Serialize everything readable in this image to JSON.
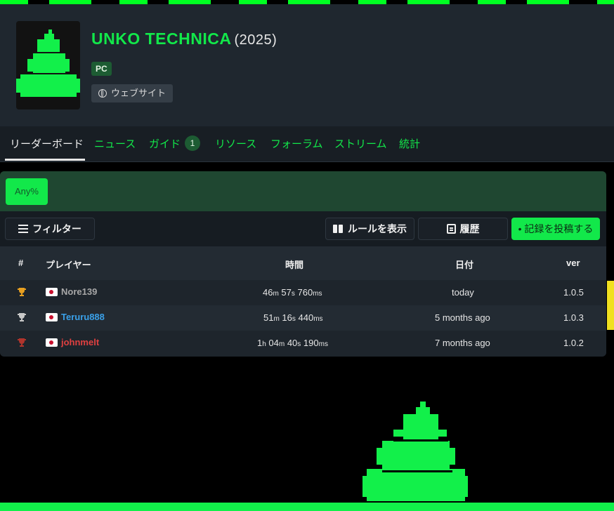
{
  "game": {
    "title": "UNKO TECHNICA",
    "year": "(2025)",
    "platform": "PC",
    "website_label": "ウェブサイト"
  },
  "tabs": [
    {
      "label": "リーダーボード",
      "active": true
    },
    {
      "label": "ニュース"
    },
    {
      "label": "ガイド",
      "badge": "1"
    },
    {
      "label": "リソース"
    },
    {
      "label": "フォーラム"
    },
    {
      "label": "ストリーム"
    },
    {
      "label": "統計"
    }
  ],
  "category": {
    "label": "Any%"
  },
  "toolbar": {
    "filter": "フィルター",
    "rules": "ルールを表示",
    "history": "履歴",
    "submit": "• 記録を投稿する"
  },
  "table": {
    "headers": {
      "rank": "#",
      "player": "プレイヤー",
      "time": "時間",
      "date": "日付",
      "ver": "ver"
    },
    "rows": [
      {
        "trophy": "gold-trophy-icon",
        "player": "Nore139",
        "time": {
          "p1": "46",
          "u1": "m",
          "p2": " 57",
          "u2": "s",
          "p3": " 760",
          "u3": "ms"
        },
        "date": "today",
        "ver": "1.0.5"
      },
      {
        "trophy": "silver-trophy-icon",
        "player": "Teruru888",
        "time": {
          "p1": "51",
          "u1": "m",
          "p2": " 16",
          "u2": "s",
          "p3": " 440",
          "u3": "ms"
        },
        "date": "5 months ago",
        "ver": "1.0.3"
      },
      {
        "trophy": "bronze-trophy-icon",
        "player": "johnmelt",
        "time": {
          "p0": "1",
          "u0": "h",
          "p1": " 04",
          "u1": "m",
          "p2": " 40",
          "u2": "s",
          "p3": " 190",
          "u3": "ms"
        },
        "date": "7 months ago",
        "ver": "1.0.2"
      }
    ]
  },
  "colors": {
    "accent": "#12e84a",
    "header_bg": "#1f272f",
    "gold": "#e8a020",
    "silver": "#c8c8c8",
    "bronze": "#b0342c"
  }
}
